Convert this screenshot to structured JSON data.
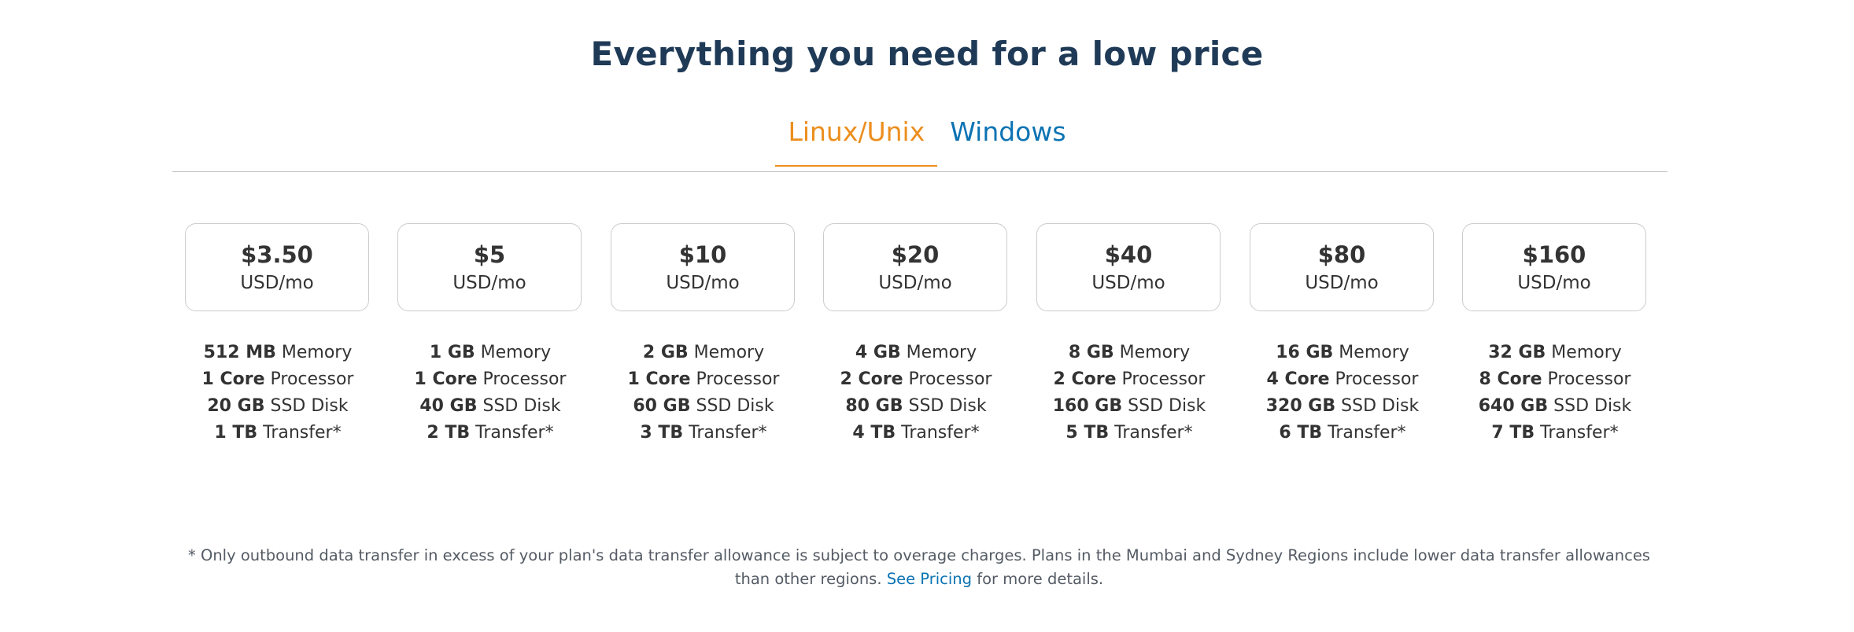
{
  "heading": "Everything you need for a low price",
  "tabs": [
    {
      "label": "Linux/Unix",
      "active": true
    },
    {
      "label": "Windows",
      "active": false
    }
  ],
  "colors": {
    "heading": "#1f3a57",
    "active_tab": "#ec8e1e",
    "link": "#0b73b3",
    "text": "#333333"
  },
  "plans": [
    {
      "price": "$3.50",
      "unit": "USD/mo",
      "memory": "512 MB",
      "memory_label": " Memory",
      "cores": "1 Core",
      "cores_label": " Processor",
      "disk": "20 GB",
      "disk_label": " SSD Disk",
      "transfer": "1 TB",
      "transfer_label": " Transfer*"
    },
    {
      "price": "$5",
      "unit": "USD/mo",
      "memory": "1 GB",
      "memory_label": " Memory",
      "cores": "1 Core",
      "cores_label": " Processor",
      "disk": "40 GB",
      "disk_label": " SSD Disk",
      "transfer": "2 TB",
      "transfer_label": " Transfer*"
    },
    {
      "price": "$10",
      "unit": "USD/mo",
      "memory": "2 GB",
      "memory_label": " Memory",
      "cores": "1 Core",
      "cores_label": " Processor",
      "disk": "60 GB",
      "disk_label": " SSD Disk",
      "transfer": "3 TB",
      "transfer_label": " Transfer*"
    },
    {
      "price": "$20",
      "unit": "USD/mo",
      "memory": "4 GB",
      "memory_label": " Memory",
      "cores": "2 Core",
      "cores_label": " Processor",
      "disk": "80 GB",
      "disk_label": " SSD Disk",
      "transfer": "4 TB",
      "transfer_label": " Transfer*"
    },
    {
      "price": "$40",
      "unit": "USD/mo",
      "memory": "8 GB",
      "memory_label": " Memory",
      "cores": "2 Core",
      "cores_label": " Processor",
      "disk": "160 GB",
      "disk_label": " SSD Disk",
      "transfer": "5 TB",
      "transfer_label": " Transfer*"
    },
    {
      "price": "$80",
      "unit": "USD/mo",
      "memory": "16 GB",
      "memory_label": " Memory",
      "cores": "4 Core",
      "cores_label": " Processor",
      "disk": "320 GB",
      "disk_label": " SSD Disk",
      "transfer": "6 TB",
      "transfer_label": " Transfer*"
    },
    {
      "price": "$160",
      "unit": "USD/mo",
      "memory": "32 GB",
      "memory_label": " Memory",
      "cores": "8 Core",
      "cores_label": " Processor",
      "disk": "640 GB",
      "disk_label": " SSD Disk",
      "transfer": "7 TB",
      "transfer_label": " Transfer*"
    }
  ],
  "footnote": {
    "text": "* Only outbound data transfer in excess of your plan's data transfer allowance is subject to overage charges. Plans in the Mumbai and Sydney Regions include lower data transfer allowances than other regions. ",
    "link_label": "See Pricing",
    "suffix": " for more details."
  }
}
